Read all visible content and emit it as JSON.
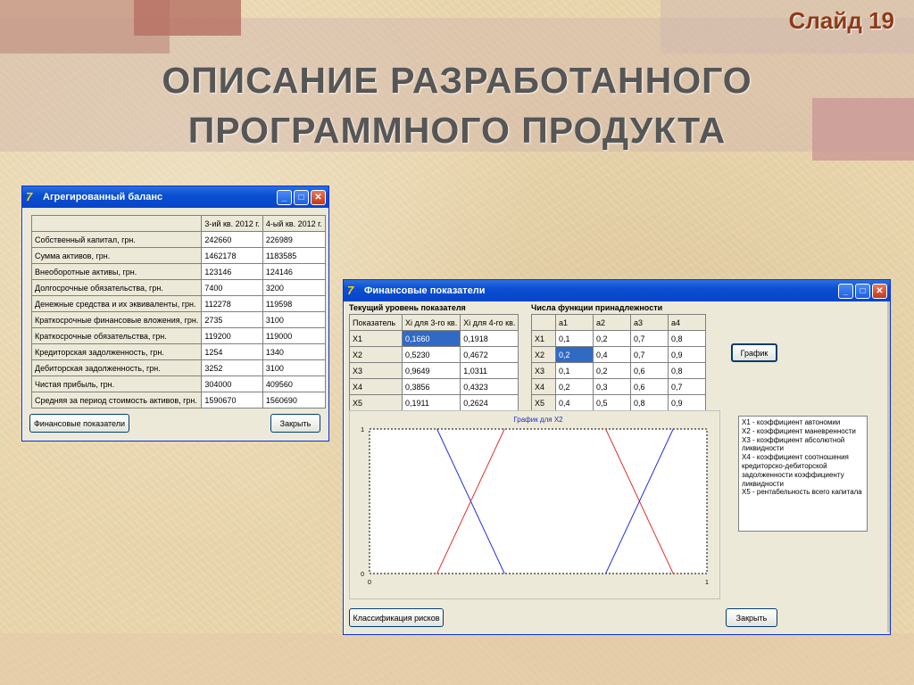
{
  "slide": {
    "number_label": "Слайд 19",
    "title_line1": "ОПИСАНИЕ РАЗРАБОТАННОГО",
    "title_line2": "ПРОГРАММНОГО ПРОДУКТА"
  },
  "balance_window": {
    "title": "Агрегированный баланс",
    "columns": [
      "",
      "3-ий кв. 2012 г.",
      "4-ый кв. 2012 г."
    ],
    "rows": [
      [
        "Собственный капитал, грн.",
        "242660",
        "226989"
      ],
      [
        "Сумма активов, грн.",
        "1462178",
        "1183585"
      ],
      [
        "Внеоборотные активы, грн.",
        "123146",
        "124146"
      ],
      [
        "Долгосрочные обязательства, грн.",
        "7400",
        "3200"
      ],
      [
        "Денежные средства и их эквиваленты, грн.",
        "112278",
        "119598"
      ],
      [
        "Краткосрочные финансовые вложения, грн.",
        "2735",
        "3100"
      ],
      [
        "Краткосрочные обязательства, грн.",
        "119200",
        "119000"
      ],
      [
        "Кредиторская задолженность, грн.",
        "1254",
        "1340"
      ],
      [
        "Дебиторская задолженность, грн.",
        "3252",
        "3100"
      ],
      [
        "Чистая прибыль, грн.",
        "304000",
        "409560"
      ],
      [
        "Средняя за период стоимость активов, грн.",
        "1590670",
        "1560690"
      ]
    ],
    "btn_fin": "Финансовые показатели",
    "btn_close": "Закрыть"
  },
  "fin_window": {
    "title": "Финансовые показатели",
    "current_label": "Текущий уровень показателя",
    "membership_label": "Числа функции принадлежности",
    "current_cols": [
      "Показатель",
      "Xi для 3-го кв.",
      "Xi для 4-го кв."
    ],
    "current_rows": [
      [
        "X1",
        "0,1660",
        "0,1918"
      ],
      [
        "X2",
        "0,5230",
        "0,4672"
      ],
      [
        "X3",
        "0,9649",
        "1,0311"
      ],
      [
        "X4",
        "0,3856",
        "0,4323"
      ],
      [
        "X5",
        "0,1911",
        "0,2624"
      ]
    ],
    "member_cols": [
      "",
      "a1",
      "a2",
      "a3",
      "a4"
    ],
    "member_rows": [
      [
        "X1",
        "0,1",
        "0,2",
        "0,7",
        "0,8"
      ],
      [
        "X2",
        "0,2",
        "0,4",
        "0,7",
        "0,9"
      ],
      [
        "X3",
        "0,1",
        "0,2",
        "0,6",
        "0,8"
      ],
      [
        "X4",
        "0,2",
        "0,3",
        "0,6",
        "0,7"
      ],
      [
        "X5",
        "0,4",
        "0,5",
        "0,8",
        "0,9"
      ]
    ],
    "btn_graph": "График",
    "legend_lines": [
      "X1 - коэффициент автономии",
      "X2 - коэффициент маневренности",
      "X3 - коэффициент абсолютной",
      "ликвидности",
      "X4 - коэффициент соотношения",
      "кредиторско-дебиторской",
      "задолженности коэффициенту",
      "ликвидности",
      "X5 - рентабельность всего капитала"
    ],
    "btn_risk": "Классификация рисков",
    "btn_close": "Закрыть"
  },
  "chart_data": {
    "type": "line",
    "title": "График для X2",
    "xlim": [
      0,
      1
    ],
    "ylim": [
      0,
      1
    ],
    "x_ticks": [
      "0",
      "1"
    ],
    "y_ticks": [
      "0",
      "1"
    ],
    "series": [
      {
        "color": "#2030e0",
        "x": [
          0.2,
          0.4
        ],
        "y": [
          1,
          0
        ]
      },
      {
        "color": "#e03030",
        "x": [
          0.2,
          0.4
        ],
        "y": [
          0,
          1
        ]
      },
      {
        "color": "#e03030",
        "x": [
          0.7,
          0.9
        ],
        "y": [
          1,
          0
        ]
      },
      {
        "color": "#2030e0",
        "x": [
          0.7,
          0.9
        ],
        "y": [
          0,
          1
        ]
      }
    ]
  }
}
